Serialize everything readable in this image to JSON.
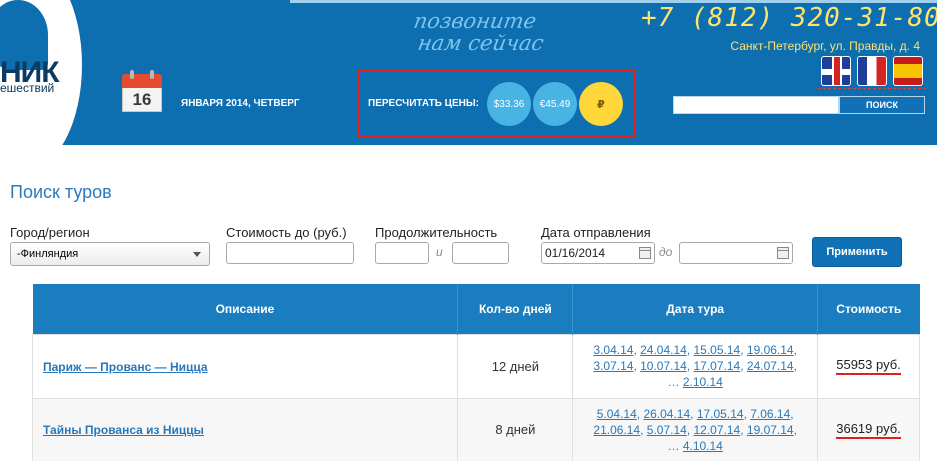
{
  "header": {
    "logo_word": "НИК",
    "logo_sub": "ешествий",
    "slogan_line1": "позвоните",
    "slogan_line2": "нам сейчас",
    "phone": "+7 (812) 320-31-80",
    "address": "Санкт-Петербург, ул. Правды, д. 4",
    "calendar_day": "16",
    "date_text": "ЯНВАРЯ 2014, ЧЕТВЕРГ",
    "currency_label": "ПЕРЕСЧИТАТЬ ЦЕНЫ:",
    "currency_usd": "$33.36",
    "currency_eur": "€45.49",
    "currency_rub": "₽",
    "search_value": "",
    "search_button": "ПОИСК",
    "colors": {
      "header_bg": "#0d6eb0",
      "accent_yellow": "#ffe36b",
      "highlight_red": "#e02020"
    }
  },
  "search_form": {
    "title": "Поиск туров",
    "region_label": "Город/регион",
    "region_value": "-Финляндия",
    "price_label": "Стоимость до (руб.)",
    "price_value": "",
    "duration_label": "Продолжительность",
    "duration_from": "",
    "duration_sep": "и",
    "duration_to": "",
    "departure_label": "Дата отправления",
    "date_from": "01/16/2014",
    "date_sep": "до",
    "date_to": "",
    "apply_button": "Применить"
  },
  "table": {
    "headers": [
      "Описание",
      "Кол-во дней",
      "Дата тура",
      "Стоимость"
    ],
    "rows": [
      {
        "title": "Париж — Прованс — Ницца",
        "days": "12 дней",
        "dates": [
          "3.04.14",
          "24.04.14",
          "15.05.14",
          "19.06.14",
          "3.07.14",
          "10.07.14",
          "17.07.14",
          "24.07.14",
          "2.10.14"
        ],
        "price": "55953 руб."
      },
      {
        "title": "Тайны Прованса из Ниццы",
        "days": "8 дней",
        "dates": [
          "5.04.14",
          "26.04.14",
          "17.05.14",
          "7.06.14",
          "21.06.14",
          "5.07.14",
          "12.07.14",
          "19.07.14",
          "4.10.14"
        ],
        "price": "36619 руб."
      }
    ]
  }
}
